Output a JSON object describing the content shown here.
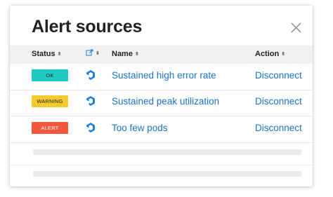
{
  "dialog": {
    "title": "Alert sources",
    "close_icon": "close-icon"
  },
  "table": {
    "columns": [
      {
        "label": "Status",
        "sort_icon": "sort-icon"
      },
      {
        "label": "",
        "icon": "source-type-icon",
        "sort_icon": "sort-icon"
      },
      {
        "label": "Name",
        "sort_icon": "sort-icon"
      },
      {
        "label": "Action",
        "sort_icon": "sort-icon"
      }
    ],
    "rows": [
      {
        "status": "OK",
        "status_color": "#1ecbc2",
        "icon": "source-logo-icon",
        "name": "Sustained high error rate",
        "action": "Disconnect"
      },
      {
        "status": "WARNING",
        "status_color": "#f7cb2f",
        "icon": "source-logo-icon",
        "name": "Sustained peak utilization",
        "action": "Disconnect"
      },
      {
        "status": "ALERT",
        "status_color": "#f0573d",
        "icon": "source-logo-icon",
        "name": "Too few pods",
        "action": "Disconnect"
      }
    ],
    "placeholder_rows": 2
  },
  "colors": {
    "link": "#1a73c7",
    "header_bg": "#f1f1f1",
    "icon_blue": "#1f7fd8"
  }
}
